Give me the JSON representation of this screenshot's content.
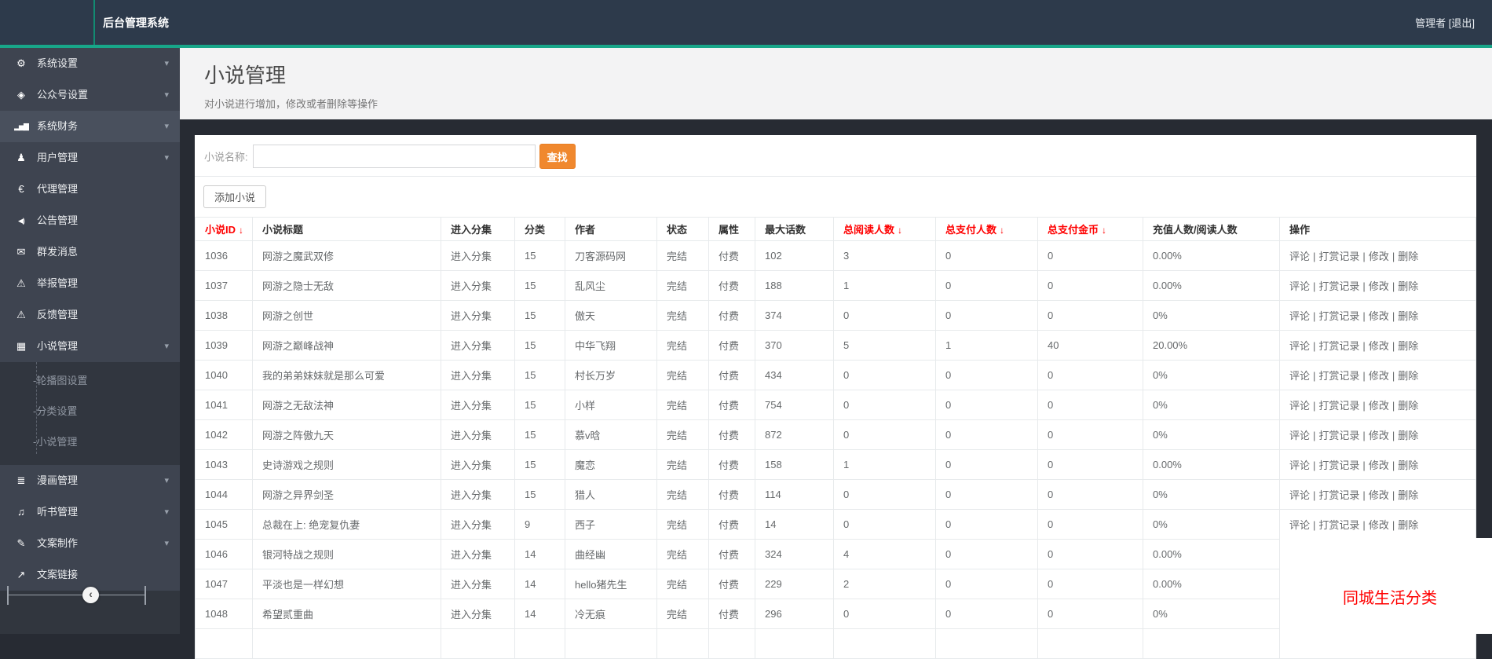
{
  "topbar": {
    "brand": "后台管理系统",
    "user": "管理者",
    "logout": "[退出]"
  },
  "sidebar": {
    "items": [
      {
        "label": "系统设置",
        "icon": "gear-icon",
        "glyph": "⚙",
        "caret": true,
        "active": false
      },
      {
        "label": "公众号设置",
        "icon": "tag-icon",
        "glyph": "◈",
        "caret": true,
        "active": false
      },
      {
        "label": "系统财务",
        "icon": "bar-chart-icon",
        "glyph": "▂▅▇",
        "caret": true,
        "active": true
      },
      {
        "label": "用户管理",
        "icon": "user-icon",
        "glyph": "♟",
        "caret": true,
        "active": false
      },
      {
        "label": "代理管理",
        "icon": "euro-icon",
        "glyph": "€",
        "caret": false,
        "active": false
      },
      {
        "label": "公告管理",
        "icon": "bullhorn-icon",
        "glyph": "◀)",
        "caret": false,
        "active": false
      },
      {
        "label": "群发消息",
        "icon": "envelope-icon",
        "glyph": "✉",
        "caret": false,
        "active": false
      },
      {
        "label": "举报管理",
        "icon": "warning-icon",
        "glyph": "⚠",
        "caret": false,
        "active": false
      },
      {
        "label": "反馈管理",
        "icon": "warning-icon",
        "glyph": "⚠",
        "caret": false,
        "active": false
      },
      {
        "label": "小说管理",
        "icon": "table-icon",
        "glyph": "▦",
        "caret": true,
        "active": false,
        "children": [
          "-轮播图设置",
          "-分类设置",
          "-小说管理"
        ]
      },
      {
        "label": "漫画管理",
        "icon": "list-icon",
        "glyph": "≣",
        "caret": true,
        "active": false
      },
      {
        "label": "听书管理",
        "icon": "audio-icon",
        "glyph": "♫",
        "caret": true,
        "active": false
      },
      {
        "label": "文案制作",
        "icon": "pencil-icon",
        "glyph": "✎",
        "caret": true,
        "active": false
      },
      {
        "label": "文案链接",
        "icon": "external-link-icon",
        "glyph": "↗",
        "caret": false,
        "active": false
      }
    ],
    "collapse_glyph": "‹"
  },
  "page": {
    "title": "小说管理",
    "subtitle": "对小说进行增加，修改或者删除等操作"
  },
  "search": {
    "label": "小说名称:",
    "value": "",
    "button": "查找"
  },
  "toolbar": {
    "add_button": "添加小说"
  },
  "table": {
    "columns": [
      {
        "label": "小说ID",
        "sort": "↓",
        "red": true
      },
      {
        "label": "小说标题"
      },
      {
        "label": "进入分集"
      },
      {
        "label": "分类"
      },
      {
        "label": "作者"
      },
      {
        "label": "状态"
      },
      {
        "label": "属性"
      },
      {
        "label": "最大话数"
      },
      {
        "label": "总阅读人数",
        "sort": "↓",
        "red": true
      },
      {
        "label": "总支付人数",
        "sort": "↓",
        "red": true
      },
      {
        "label": "总支付金币",
        "sort": "↓",
        "red": true
      },
      {
        "label": "充值人数/阅读人数"
      },
      {
        "label": "操作"
      }
    ],
    "enter_label": "进入分集",
    "ops": [
      "评论",
      "打赏记录",
      "修改",
      "删除"
    ],
    "ops_separator": "|",
    "rows": [
      {
        "id": "1036",
        "title": "网游之魔武双修",
        "category": "15",
        "author": "刀客源码网",
        "status": "完结",
        "attr": "付费",
        "max_episodes": "102",
        "total_reads": "3",
        "total_payers": "0",
        "total_coins": "0",
        "ratio": "0.00%",
        "ops_hidden": false
      },
      {
        "id": "1037",
        "title": "网游之隐士无敌",
        "category": "15",
        "author": "乱风尘",
        "status": "完结",
        "attr": "付费",
        "max_episodes": "188",
        "total_reads": "1",
        "total_payers": "0",
        "total_coins": "0",
        "ratio": "0.00%",
        "ops_hidden": false
      },
      {
        "id": "1038",
        "title": "网游之创世",
        "category": "15",
        "author": "傲天",
        "status": "完结",
        "attr": "付费",
        "max_episodes": "374",
        "total_reads": "0",
        "total_payers": "0",
        "total_coins": "0",
        "ratio": "0%",
        "ops_hidden": false
      },
      {
        "id": "1039",
        "title": "网游之巅峰战神",
        "category": "15",
        "author": "中华飞翔",
        "status": "完结",
        "attr": "付费",
        "max_episodes": "370",
        "total_reads": "5",
        "total_payers": "1",
        "total_coins": "40",
        "ratio": "20.00%",
        "ops_hidden": false
      },
      {
        "id": "1040",
        "title": "我的弟弟妹妹就是那么可爱",
        "category": "15",
        "author": "村长万岁",
        "status": "完结",
        "attr": "付费",
        "max_episodes": "434",
        "total_reads": "0",
        "total_payers": "0",
        "total_coins": "0",
        "ratio": "0%",
        "ops_hidden": false
      },
      {
        "id": "1041",
        "title": "网游之无敌法神",
        "category": "15",
        "author": "小样",
        "status": "完结",
        "attr": "付费",
        "max_episodes": "754",
        "total_reads": "0",
        "total_payers": "0",
        "total_coins": "0",
        "ratio": "0%",
        "ops_hidden": false
      },
      {
        "id": "1042",
        "title": "网游之阵傲九天",
        "category": "15",
        "author": "慕v晗",
        "status": "完结",
        "attr": "付费",
        "max_episodes": "872",
        "total_reads": "0",
        "total_payers": "0",
        "total_coins": "0",
        "ratio": "0%",
        "ops_hidden": false
      },
      {
        "id": "1043",
        "title": "史诗游戏之规则",
        "category": "15",
        "author": "魔恋",
        "status": "完结",
        "attr": "付费",
        "max_episodes": "158",
        "total_reads": "1",
        "total_payers": "0",
        "total_coins": "0",
        "ratio": "0.00%",
        "ops_hidden": false
      },
      {
        "id": "1044",
        "title": "网游之异界剑圣",
        "category": "15",
        "author": "猎人",
        "status": "完结",
        "attr": "付费",
        "max_episodes": "114",
        "total_reads": "0",
        "total_payers": "0",
        "total_coins": "0",
        "ratio": "0%",
        "ops_hidden": false
      },
      {
        "id": "1045",
        "title": "总裁在上: 绝宠复仇妻",
        "category": "9",
        "author": "西子",
        "status": "完结",
        "attr": "付费",
        "max_episodes": "14",
        "total_reads": "0",
        "total_payers": "0",
        "total_coins": "0",
        "ratio": "0%",
        "ops_hidden": false
      },
      {
        "id": "1046",
        "title": "银河特战之规则",
        "category": "14",
        "author": "曲经幽",
        "status": "完结",
        "attr": "付费",
        "max_episodes": "324",
        "total_reads": "4",
        "total_payers": "0",
        "total_coins": "0",
        "ratio": "0.00%",
        "ops_hidden": true
      },
      {
        "id": "1047",
        "title": "平淡也是一样幻想",
        "category": "14",
        "author": "hello猪先生",
        "status": "完结",
        "attr": "付费",
        "max_episodes": "229",
        "total_reads": "2",
        "total_payers": "0",
        "total_coins": "0",
        "ratio": "0.00%",
        "ops_hidden": true
      },
      {
        "id": "1048",
        "title": "希望贰重曲",
        "category": "14",
        "author": "冷无痕",
        "status": "完结",
        "attr": "付费",
        "max_episodes": "296",
        "total_reads": "0",
        "total_payers": "0",
        "total_coins": "0",
        "ratio": "0%",
        "ops_hidden": true
      }
    ]
  },
  "overlay": {
    "text": "同城生活分类"
  },
  "colors": {
    "accent_green": "#18a689",
    "button_orange": "#f0882e",
    "sort_red": "#ff0000",
    "overlay_text_red": "#ff0000"
  }
}
